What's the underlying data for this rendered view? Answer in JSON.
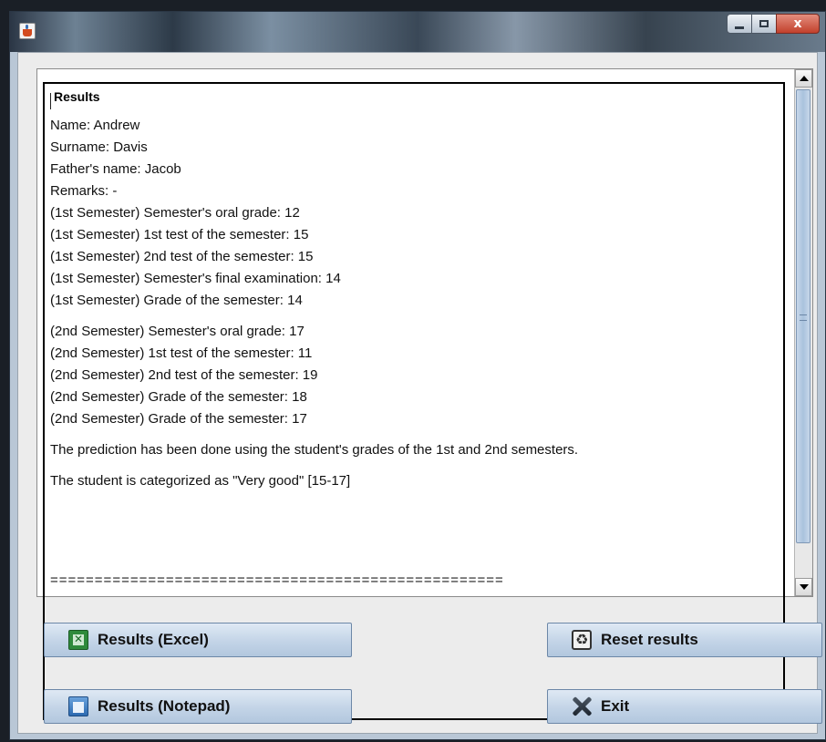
{
  "window": {
    "controls": {
      "minimize_icon": "minimize-icon",
      "maximize_icon": "maximize-icon",
      "close_glyph": "x"
    }
  },
  "results": {
    "legend": "Results",
    "lines": [
      "Name: Andrew",
      "Surname: Davis",
      "Father's name: Jacob",
      "Remarks: -",
      "(1st Semester) Semester's oral grade: 12",
      "(1st Semester) 1st test of the semester: 15",
      "(1st Semester) 2nd test of the semester: 15",
      "(1st Semester) Semester's final examination: 14",
      "(1st Semester) Grade of the semester: 14",
      "(2nd Semester) Semester's oral grade: 17",
      "(2nd Semester) 1st test of the semester: 11",
      "(2nd Semester) 2nd test of the semester: 19",
      "(2nd Semester) Grade of the semester: 18",
      "(2nd Semester) Grade of the semester: 17",
      "The prediction has been done using the student's grades of the 1st and 2nd semesters.",
      "The student is categorized as \"Very good\" [15-17]"
    ],
    "separator": "==================================================="
  },
  "buttons": {
    "excel": "Results (Excel)",
    "reset": "Reset results",
    "notepad": "Results (Notepad)",
    "exit": "Exit"
  },
  "colors": {
    "button_top": "#dfe9f4",
    "button_bottom": "#b2c7de",
    "scroll_thumb": "#a9c2dd"
  }
}
